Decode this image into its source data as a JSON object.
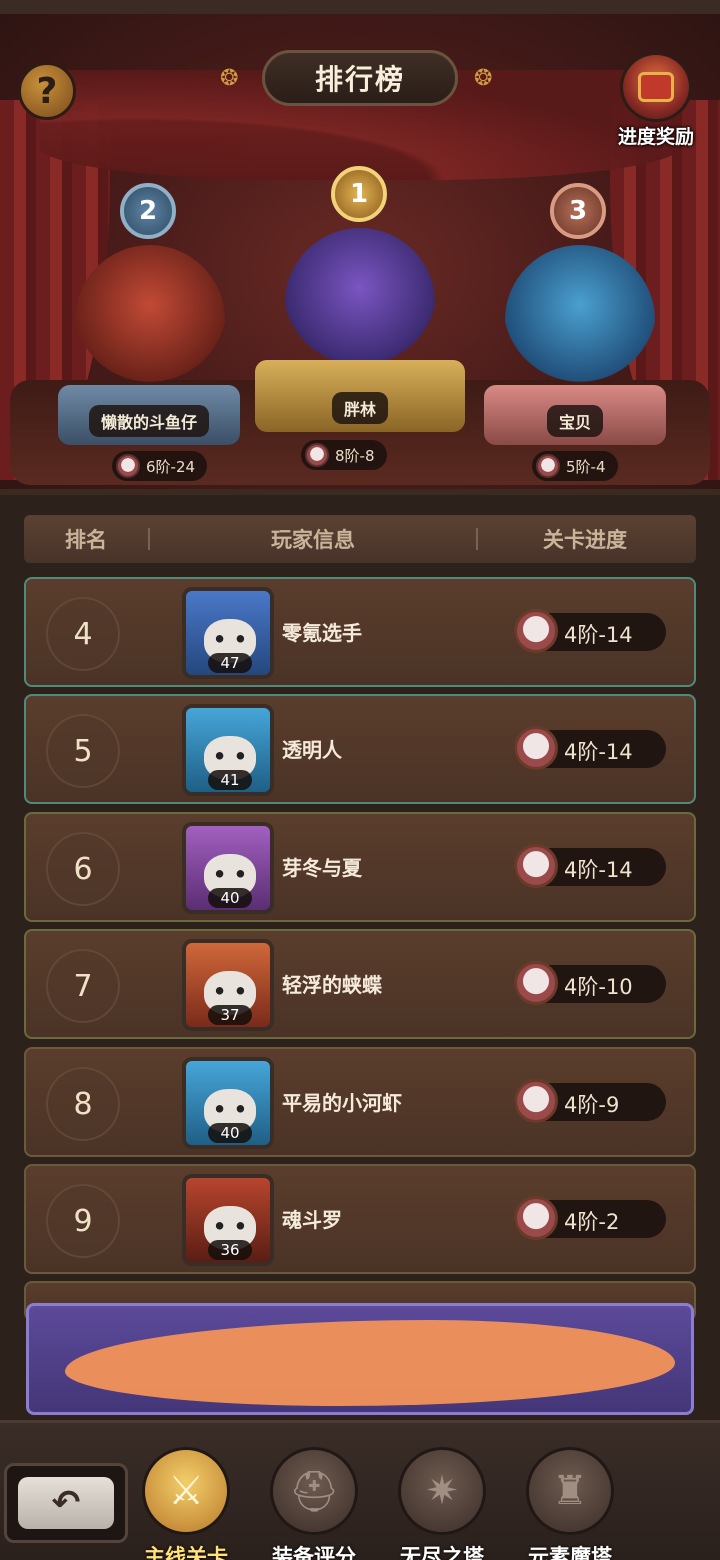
{
  "header": {
    "title": "排行榜",
    "help_icon": "?",
    "reward_label": "进度奖励"
  },
  "podium": [
    {
      "rank": "2",
      "name": "懒散的斗鱼仔",
      "progress": "6阶-24"
    },
    {
      "rank": "1",
      "name": "胖林",
      "progress": "8阶-8"
    },
    {
      "rank": "3",
      "name": "宝贝",
      "progress": "5阶-4"
    }
  ],
  "table": {
    "columns": [
      "排名",
      "玩家信息",
      "关卡进度"
    ],
    "rows": [
      {
        "rank": "4",
        "level": "47",
        "name": "零氪选手",
        "progress": "4阶-14"
      },
      {
        "rank": "5",
        "level": "41",
        "name": "透明人",
        "progress": "4阶-14"
      },
      {
        "rank": "6",
        "level": "40",
        "name": "芽冬与夏",
        "progress": "4阶-14"
      },
      {
        "rank": "7",
        "level": "37",
        "name": "轻浮的蛱蝶",
        "progress": "4阶-10"
      },
      {
        "rank": "8",
        "level": "40",
        "name": "平易的小河虾",
        "progress": "4阶-9"
      },
      {
        "rank": "9",
        "level": "36",
        "name": "魂斗罗",
        "progress": "4阶-2"
      }
    ]
  },
  "nav": {
    "back_icon": "↶",
    "tabs": [
      {
        "label": "主线关卡",
        "icon": "crossed-swords-icon",
        "glyph": "⚔"
      },
      {
        "label": "装备评分",
        "icon": "helmet-icon",
        "glyph": "⛑"
      },
      {
        "label": "无尽之塔",
        "icon": "star-badge-icon",
        "glyph": "✷"
      },
      {
        "label": "元素魔塔",
        "icon": "castle-icon",
        "glyph": "♜"
      }
    ]
  },
  "colors": {
    "accent_gold": "#d39b43",
    "self_row": "#5c4a9a",
    "active_tab": "#ffe27a"
  }
}
